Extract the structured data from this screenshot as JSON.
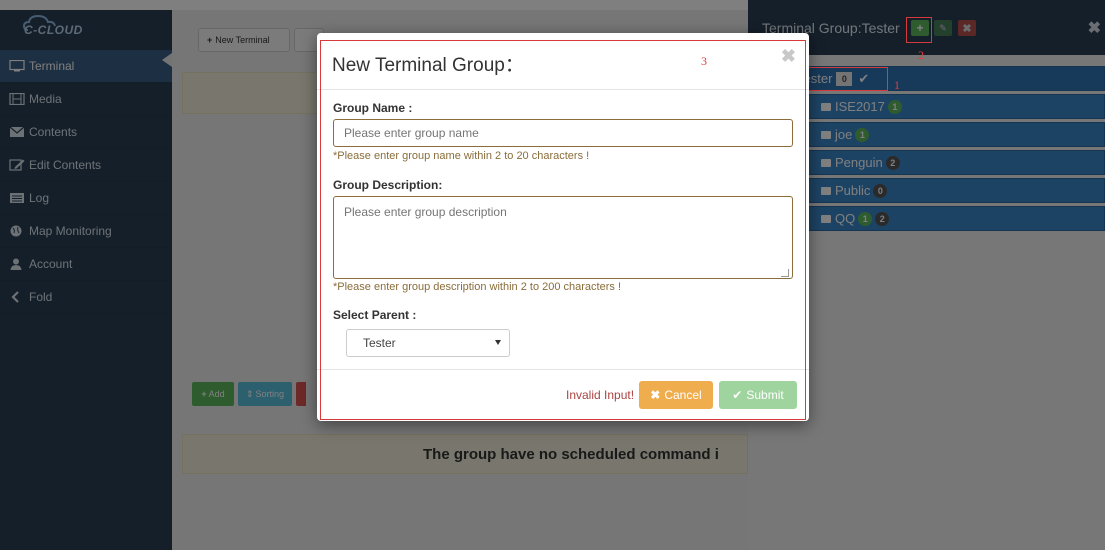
{
  "app": {
    "logo_text": "C-CLOUD"
  },
  "sidebar": {
    "items": [
      {
        "label": "Terminal",
        "icon": "monitor-icon",
        "active": true
      },
      {
        "label": "Media",
        "icon": "film-icon"
      },
      {
        "label": "Contents",
        "icon": "envelope-icon"
      },
      {
        "label": "Edit Contents",
        "icon": "edit-icon"
      },
      {
        "label": "Log",
        "icon": "list-icon"
      },
      {
        "label": "Map Monitoring",
        "icon": "globe-icon"
      },
      {
        "label": "Account",
        "icon": "user-icon"
      },
      {
        "label": "Fold",
        "icon": "chevron-left-icon"
      }
    ]
  },
  "main": {
    "new_terminal_label": "New Terminal",
    "add_label": "Add",
    "sorting_label": "Sorting",
    "empty_message": "The group have no scheduled command i"
  },
  "right_panel": {
    "title": "Terminal Group:Tester",
    "groups": [
      {
        "name": "Tester",
        "badge": "0",
        "selected": true
      },
      {
        "name": "ISE2017",
        "badges": [
          {
            "value": "1",
            "color": "green"
          }
        ]
      },
      {
        "name": "joe",
        "badges": [
          {
            "value": "1",
            "color": "green"
          }
        ]
      },
      {
        "name": "Penguin",
        "badges": [
          {
            "value": "2",
            "color": "gray"
          }
        ]
      },
      {
        "name": "Public",
        "badges": [
          {
            "value": "0",
            "color": "gray"
          }
        ]
      },
      {
        "name": "QQ",
        "badges": [
          {
            "value": "1",
            "color": "green"
          },
          {
            "value": "2",
            "color": "gray"
          }
        ]
      }
    ]
  },
  "annotations": {
    "one": "1",
    "two": "2",
    "three": "3"
  },
  "modal": {
    "title": "New Terminal Group：",
    "group_name_label": "Group Name :",
    "group_name_placeholder": "Please enter group name",
    "group_name_help": "*Please enter group name within 2 to 20 characters !",
    "group_desc_label": "Group Description:",
    "group_desc_placeholder": "Please enter group description",
    "group_desc_help": "*Please enter group description within 2 to 200 characters !",
    "parent_label": "Select Parent :",
    "parent_value": "Tester",
    "invalid_text": "Invalid Input!",
    "cancel_label": "Cancel",
    "submit_label": "Submit"
  },
  "colors": {
    "sidebar_bg": "#2a3f54",
    "accent_blue": "#3278b8",
    "success": "#5cb85c",
    "warning": "#f0ad4e",
    "danger": "#d9534f",
    "help_text": "#8a6d3b",
    "annotation_red": "#e43c3c"
  }
}
